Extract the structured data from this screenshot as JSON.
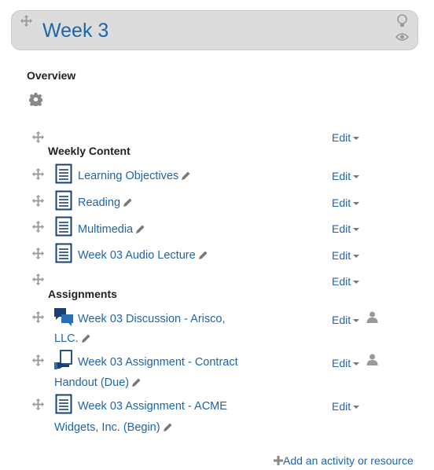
{
  "header": {
    "title": "Week 3"
  },
  "overview": {
    "label": "Overview"
  },
  "sections": {
    "weekly_content": "Weekly Content",
    "assignments": "Assignments"
  },
  "items": [
    {
      "title": "Learning Objectives",
      "edit": "Edit"
    },
    {
      "title": "Reading",
      "edit": "Edit"
    },
    {
      "title": "Multimedia",
      "edit": "Edit"
    },
    {
      "title": "Week 03 Audio Lecture",
      "edit": "Edit"
    },
    {
      "title_line1": "Week 03 Discussion - Arisco,",
      "title_line2": "LLC.",
      "edit": "Edit"
    },
    {
      "title_line1": "Week 03 Assignment - Contract",
      "title_line2": "Handout (Due)",
      "edit": "Edit"
    },
    {
      "title_line1": "Week 03 Assignment - ACME",
      "title_line2": "Widgets, Inc. (Begin)",
      "edit": "Edit"
    }
  ],
  "label_edits": {
    "weekly_content_edit": "Edit",
    "assignments_edit": "Edit"
  },
  "footer": {
    "add_activity": "Add an activity or resource"
  },
  "icons": {
    "move": "move-icon",
    "doc": "page-icon",
    "forum": "forum-icon",
    "assign": "assignment-icon",
    "pencil": "pencil-icon",
    "gear": "gear-icon",
    "lightbulb": "lightbulb-icon",
    "eye": "eye-icon",
    "person": "person-icon"
  },
  "colors": {
    "link": "#1f65a8",
    "header_bg": "#dcdcdc"
  }
}
